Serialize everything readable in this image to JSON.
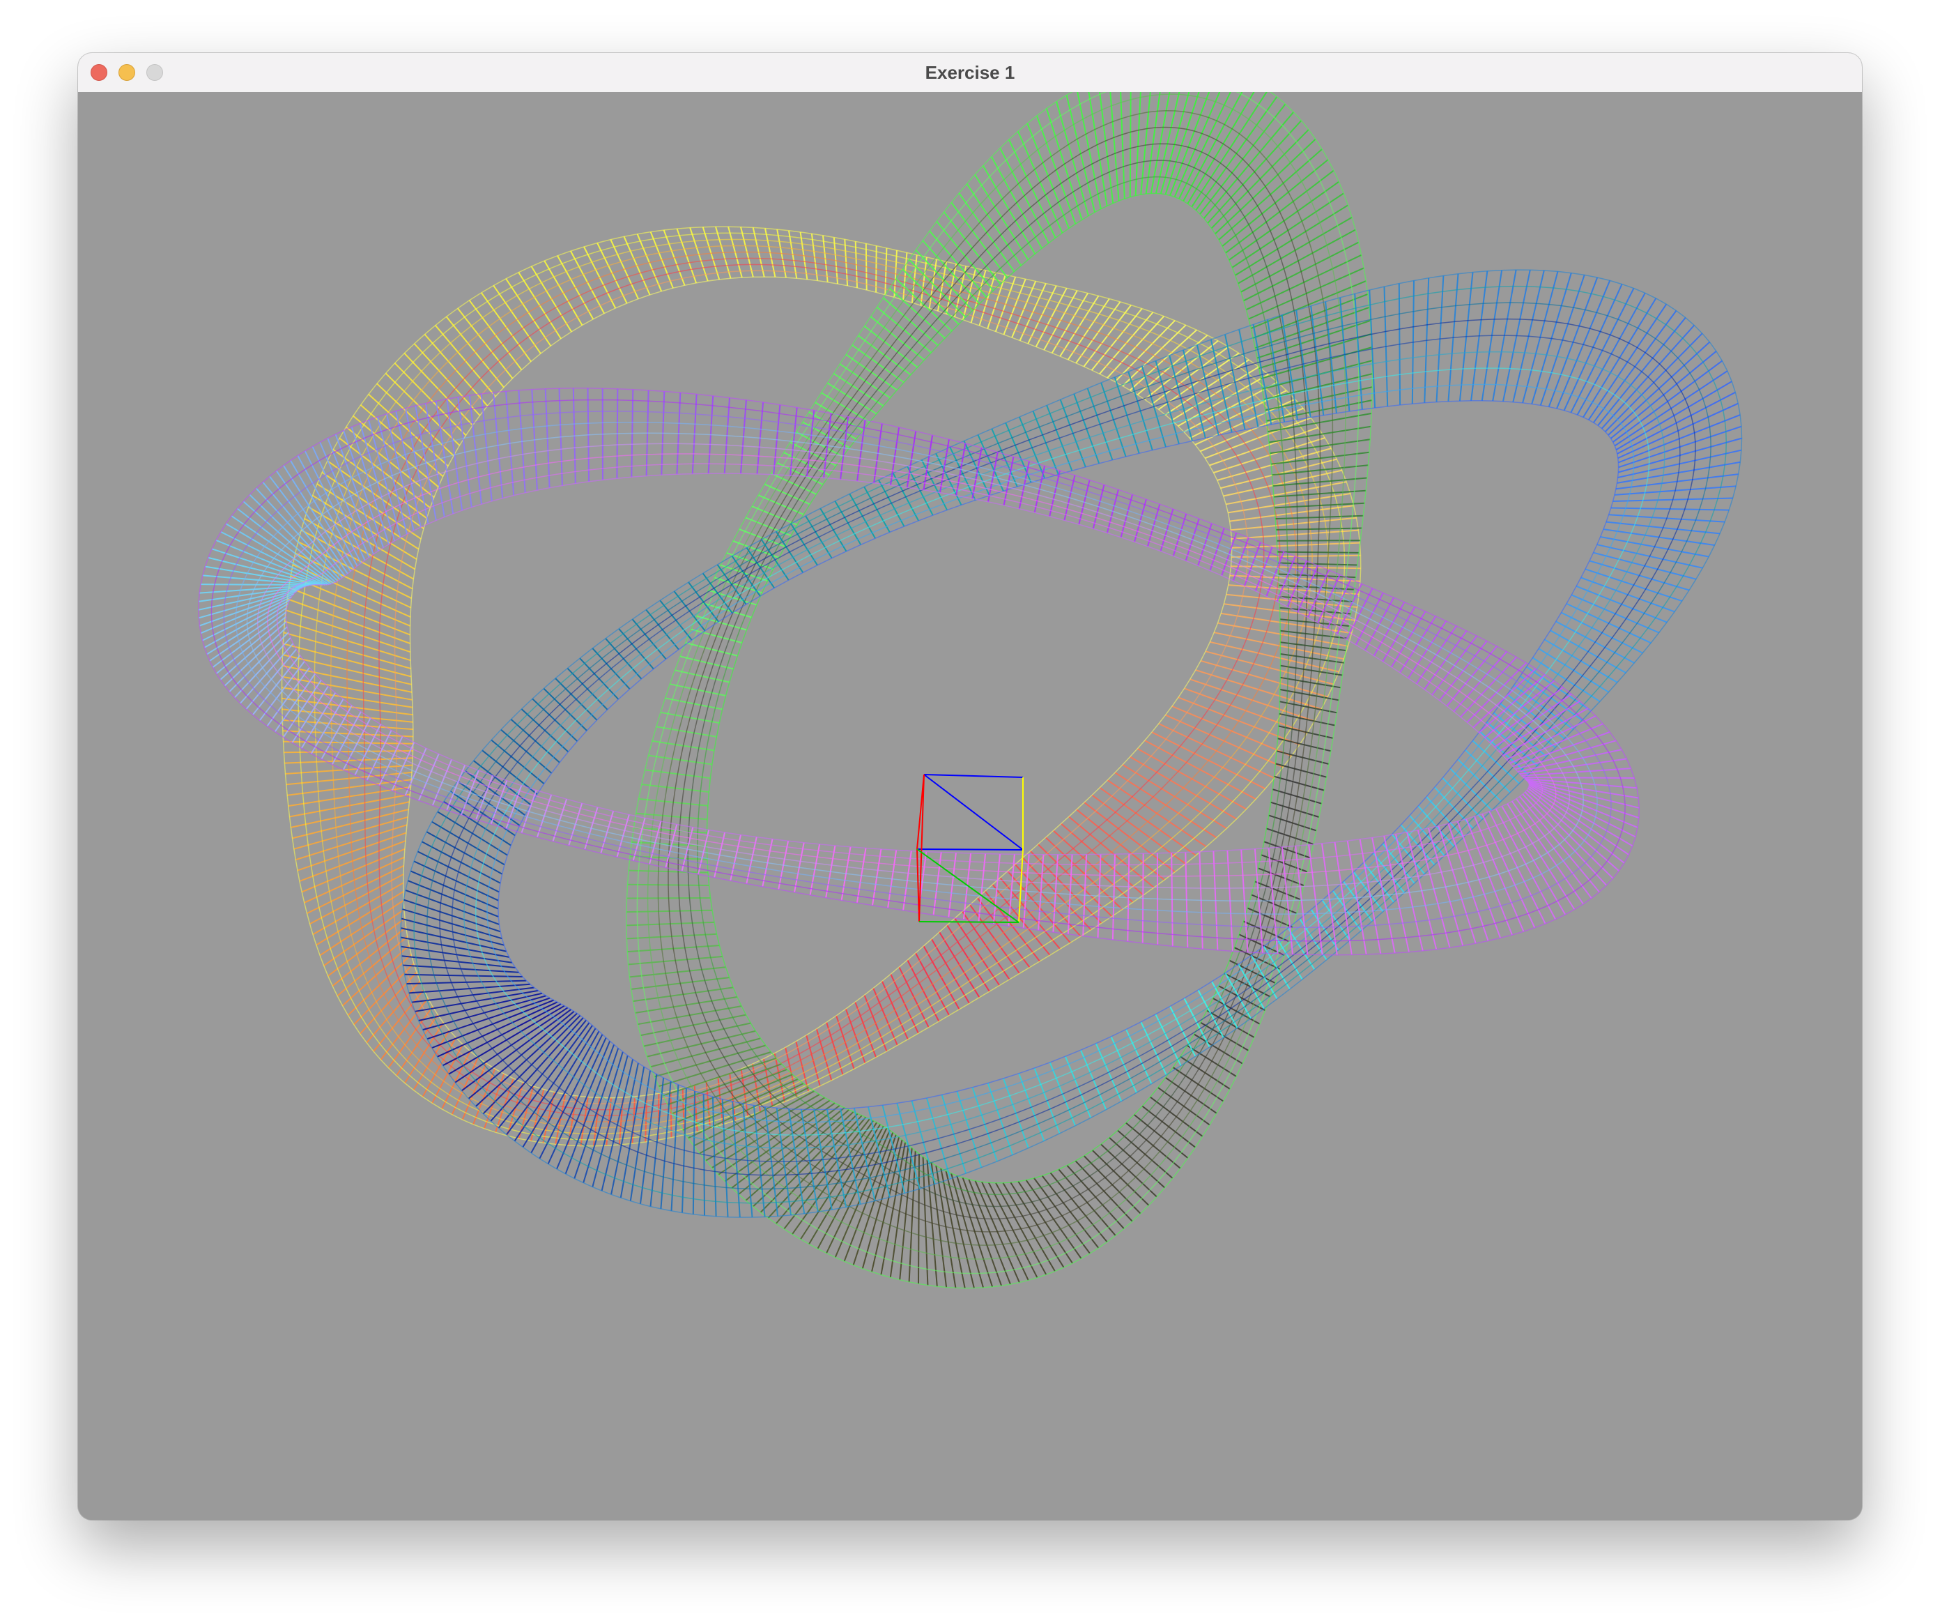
{
  "window": {
    "title": "Exercise 1",
    "background_color": "#9a9a9a",
    "controls": [
      "close-icon",
      "minimize-icon",
      "zoom-icon"
    ]
  },
  "scene": {
    "description_type": "wireframe-render",
    "ring_count": 4,
    "ring_colors": [
      [
        "#ffff66",
        "#ff2244",
        "#ff9933",
        "#ffff33"
      ],
      [
        "#33ff33",
        "#333333",
        "#444422",
        "#66ff66"
      ],
      [
        "#3366ff",
        "#33ffee",
        "#000099",
        "#00aaaa"
      ],
      [
        "#cc66ff",
        "#ff66ff",
        "#66ddff",
        "#aa22ff"
      ]
    ],
    "axis_colors": {
      "x": "#ff0000",
      "y": "#00cc00",
      "z": "#0000ff",
      "w": "#ffff00"
    }
  }
}
